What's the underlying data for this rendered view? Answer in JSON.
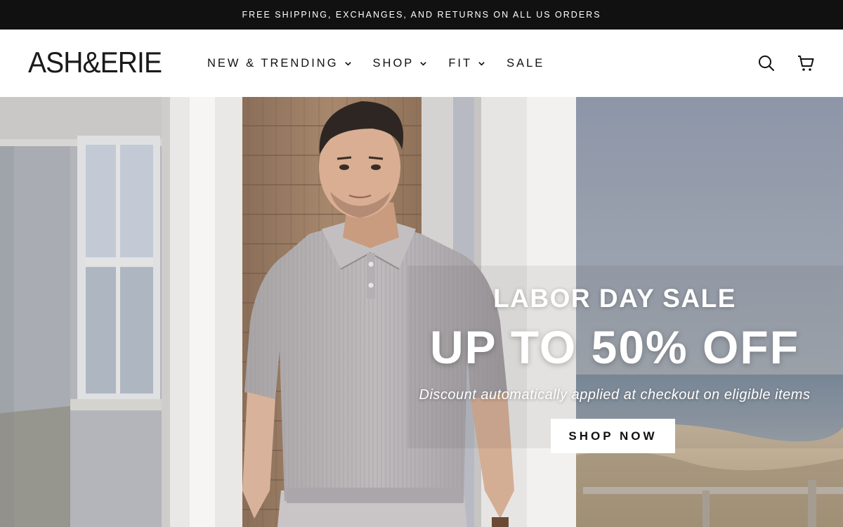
{
  "announcement": {
    "text": "FREE SHIPPING, EXCHANGES, AND RETURNS ON ALL US ORDERS"
  },
  "header": {
    "logo": "ASH&ERIE",
    "nav": [
      {
        "label": "NEW & TRENDING",
        "has_dropdown": true
      },
      {
        "label": "SHOP",
        "has_dropdown": true
      },
      {
        "label": "FIT",
        "has_dropdown": true
      },
      {
        "label": "SALE",
        "has_dropdown": false
      }
    ],
    "icons": [
      "search-icon",
      "cart-icon"
    ]
  },
  "hero": {
    "kicker": "LABOR DAY SALE",
    "headline": "UP TO 50% OFF",
    "subtext": "Discount automatically applied at checkout on eligible items",
    "cta_label": "SHOP NOW"
  },
  "colors": {
    "announcement_bg": "#111111",
    "text_dark": "#111111",
    "cta_bg": "#ffffff"
  }
}
